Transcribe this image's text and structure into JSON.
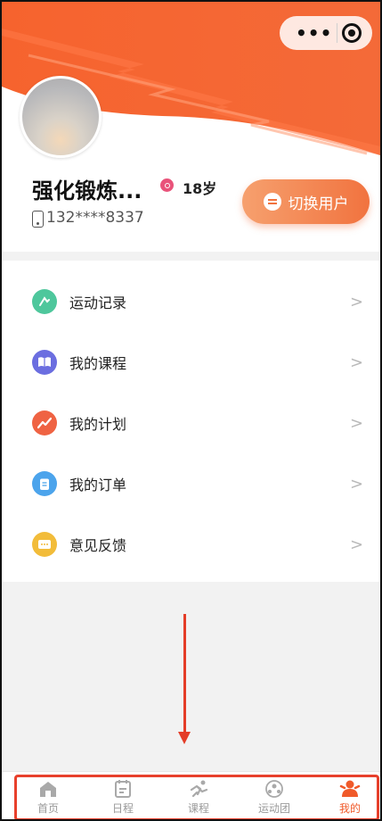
{
  "capsule": {
    "more_glyph": "•••"
  },
  "profile": {
    "username": "强化锻炼...",
    "age": "18岁",
    "phone": "132****8337",
    "switch_user_label": "切换用户"
  },
  "menu": {
    "items": [
      {
        "label": "运动记录",
        "icon": "sport-record-icon",
        "color": "#4ec79c"
      },
      {
        "label": "我的课程",
        "icon": "course-book-icon",
        "color": "#6b6ee0"
      },
      {
        "label": "我的计划",
        "icon": "plan-trend-icon",
        "color": "#ef6343"
      },
      {
        "label": "我的订单",
        "icon": "order-clipboard-icon",
        "color": "#4ca4ec"
      },
      {
        "label": "意见反馈",
        "icon": "feedback-message-icon",
        "color": "#f2bc3a"
      }
    ],
    "chevron": ">"
  },
  "tabbar": {
    "tabs": [
      {
        "label": "首页",
        "icon": "home-icon"
      },
      {
        "label": "日程",
        "icon": "schedule-icon"
      },
      {
        "label": "课程",
        "icon": "course-run-icon"
      },
      {
        "label": "运动团",
        "icon": "group-icon"
      },
      {
        "label": "我的",
        "icon": "profile-icon",
        "active": true
      }
    ]
  },
  "colors": {
    "brand_orange": "#f05a2a",
    "annotation_red": "#e43d28"
  }
}
